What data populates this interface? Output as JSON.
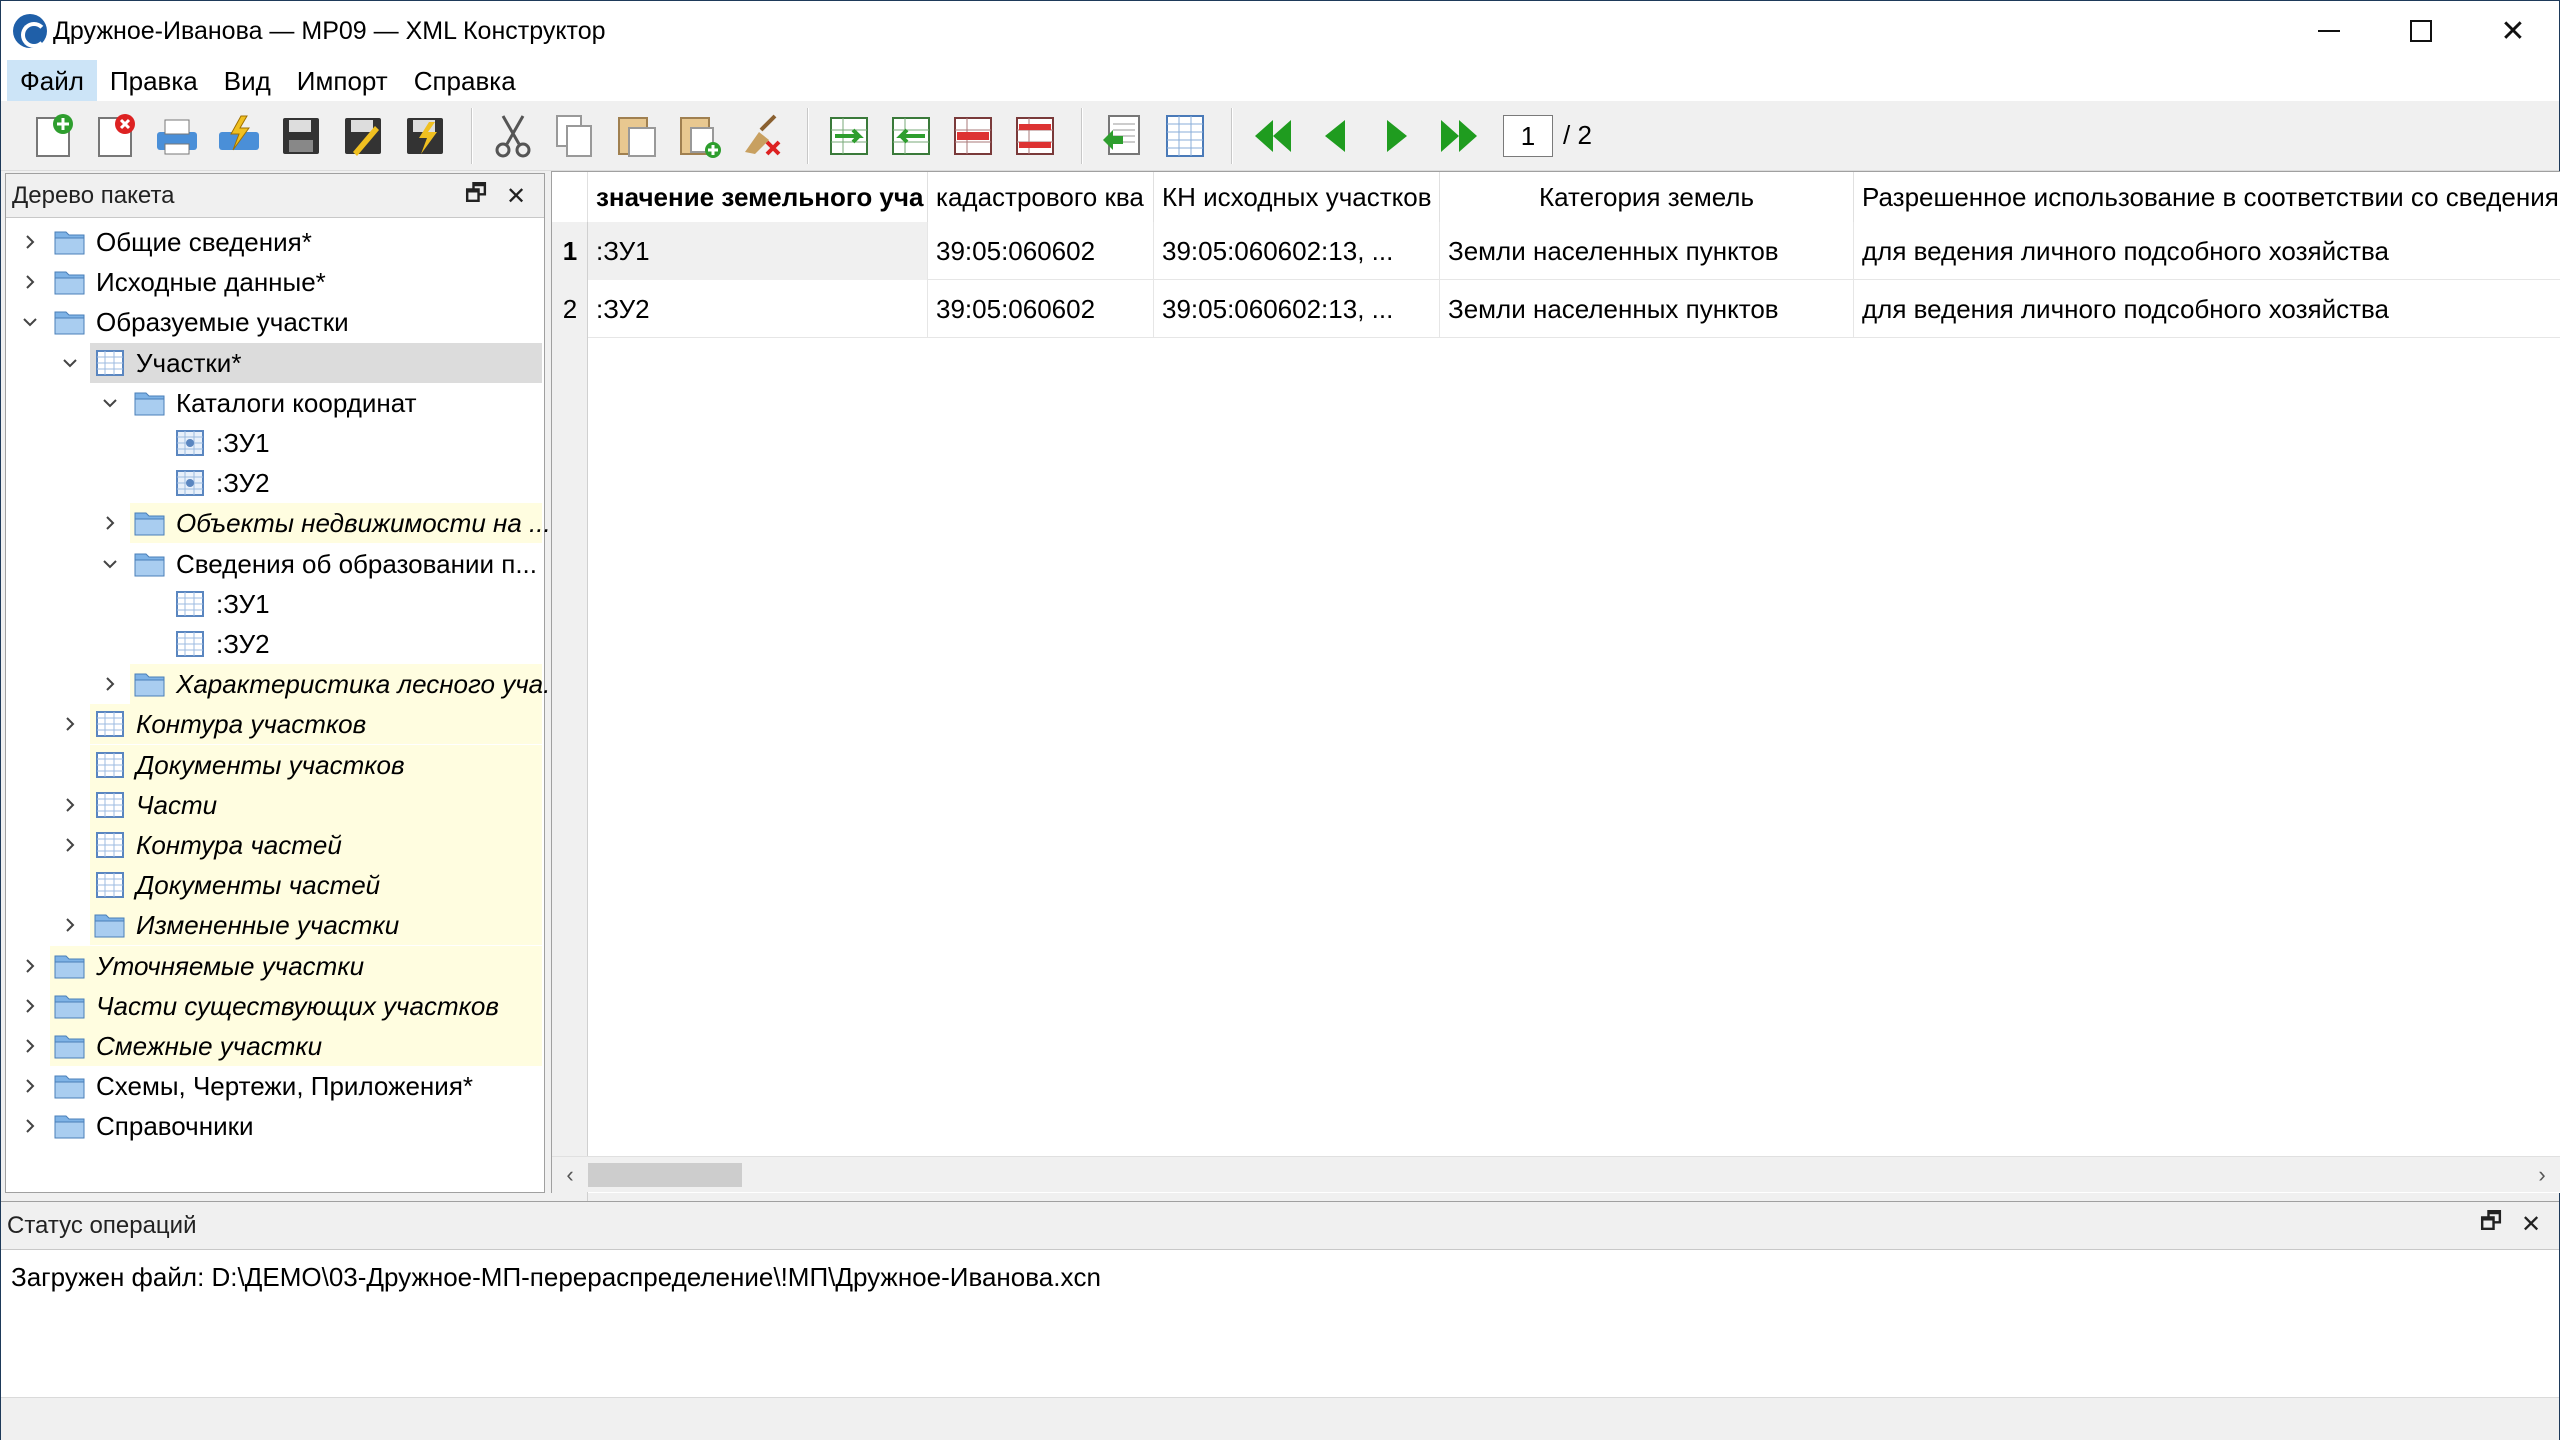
{
  "window": {
    "title": "Дружное-Иванова — МР09 — XML Конструктор",
    "minimize": "",
    "maximize": "",
    "close": "✕"
  },
  "menu": [
    "Файл",
    "Правка",
    "Вид",
    "Импорт",
    "Справка"
  ],
  "toolbar": {
    "icons": [
      "new-doc-icon",
      "close-doc-icon",
      "print-icon",
      "validate-icon",
      "save-icon",
      "save-as-icon",
      "save-validate-icon",
      "cut-icon",
      "copy-icon",
      "paste-icon",
      "paste-special-icon",
      "clear-icon",
      "insert-row-before-icon",
      "insert-row-after-icon",
      "delete-row-icon",
      "delete-rows-icon",
      "open-editor-icon",
      "table-view-icon",
      "first-page-icon",
      "prev-page-icon",
      "next-page-icon",
      "last-page-icon"
    ],
    "page_current": "1",
    "page_total": "/ 2"
  },
  "tree_panel": {
    "title": "Дерево пакета",
    "restore": "🗗",
    "close": "✕",
    "items": [
      {
        "label": "Общие сведения*"
      },
      {
        "label": "Исходные данные*"
      },
      {
        "label": "Образуемые участки"
      },
      {
        "label": "Участки*"
      },
      {
        "label": "Каталоги координат"
      },
      {
        "label": ":ЗУ1"
      },
      {
        "label": ":ЗУ2"
      },
      {
        "label": "Объекты недвижимости на ..."
      },
      {
        "label": "Сведения об образовании п..."
      },
      {
        "label": ":ЗУ1"
      },
      {
        "label": ":ЗУ2"
      },
      {
        "label": "Характеристика лесного уча..."
      },
      {
        "label": "Контура участков"
      },
      {
        "label": "Документы участков"
      },
      {
        "label": "Части"
      },
      {
        "label": "Контура частей"
      },
      {
        "label": "Документы частей"
      },
      {
        "label": "Измененные участки"
      },
      {
        "label": "Уточняемые участки"
      },
      {
        "label": "Части существующих участков"
      },
      {
        "label": "Смежные участки"
      },
      {
        "label": "Схемы, Чертежи, Приложения*"
      },
      {
        "label": "Справочники"
      }
    ]
  },
  "grid": {
    "columns": [
      "значение земельного уча",
      "кадастрового ква",
      "КН исходных участков",
      "Категория земель",
      "Разрешенное использование в соответствии со сведения"
    ],
    "rows": [
      {
        "num": "1",
        "cells": [
          ":ЗУ1",
          "39:05:060602",
          "39:05:060602:13, ...",
          "Земли населенных пунктов",
          "для ведения личного подсобного хозяйства"
        ]
      },
      {
        "num": "2",
        "cells": [
          ":ЗУ2",
          "39:05:060602",
          "39:05:060602:13, ...",
          "Земли населенных пунктов",
          "для ведения личного подсобного хозяйства"
        ]
      }
    ],
    "scroll_left": "‹",
    "scroll_right": "›"
  },
  "status_panel": {
    "title": "Статус операций",
    "restore": "🗗",
    "close": "✕",
    "message": "Загружен файл: D:\\ДЕМО\\03-Дружное-МП-перераспределение\\!МП\\Дружное-Иванова.xcn"
  },
  "colors": {
    "highlight_yellow": "#fffde0",
    "selection_gray": "#e5e5e5",
    "menu_active": "#cce4f7",
    "arrow_green": "#1f9c1f"
  }
}
